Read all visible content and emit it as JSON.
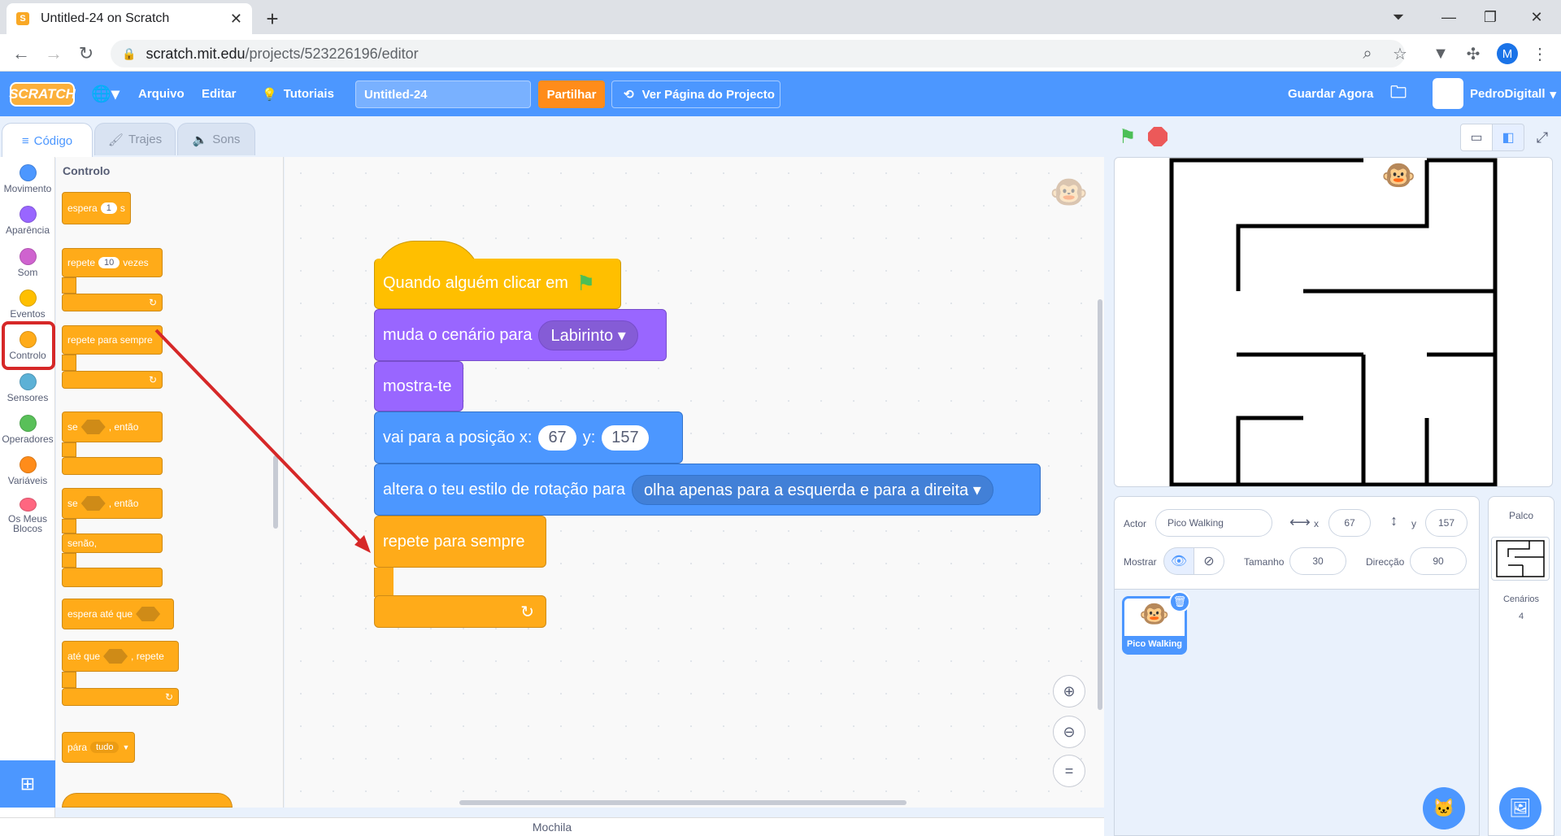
{
  "browser": {
    "tab_title": "Untitled-24 on Scratch",
    "new_tab": "+",
    "url_host": "scratch.mit.edu",
    "url_path": "/projects/523226196/editor",
    "profile_initial": "M"
  },
  "menubar": {
    "logo": "SCRATCH",
    "file": "Arquivo",
    "edit": "Editar",
    "tutorials": "Tutoriais",
    "project_title": "Untitled-24",
    "share": "Partilhar",
    "see_project": "Ver Página do Projecto",
    "save_now": "Guardar Agora",
    "username": "PedroDigitall"
  },
  "editor_tabs": {
    "code": "Código",
    "costumes": "Trajes",
    "sounds": "Sons"
  },
  "categories": [
    {
      "label": "Movimento",
      "color": "#4c97ff"
    },
    {
      "label": "Aparência",
      "color": "#9966ff"
    },
    {
      "label": "Som",
      "color": "#cf63cf"
    },
    {
      "label": "Eventos",
      "color": "#ffbf00"
    },
    {
      "label": "Controlo",
      "color": "#ffab19"
    },
    {
      "label": "Sensores",
      "color": "#5cb1d6"
    },
    {
      "label": "Operadores",
      "color": "#59c059"
    },
    {
      "label": "Variáveis",
      "color": "#ff8c1a"
    },
    {
      "label": "Os Meus Blocos",
      "color": "#ff6680"
    }
  ],
  "palette": {
    "title": "Controlo",
    "wait": {
      "label": "espera",
      "value": "1",
      "unit": "s"
    },
    "repeat": {
      "label": "repete",
      "value": "10",
      "unit": "vezes"
    },
    "forever": "repete para sempre",
    "if_then": {
      "if": "se",
      "then": ", então"
    },
    "if_else": {
      "if": "se",
      "then": ", então",
      "else": "senão,"
    },
    "wait_until": "espera até que",
    "repeat_until": {
      "label": "até que",
      "suffix": ", repete"
    },
    "stop": {
      "label": "pára",
      "option": "tudo"
    }
  },
  "script": {
    "hat": "Quando alguém clicar em",
    "backdrop": {
      "label": "muda o cenário para",
      "value": "Labirinto"
    },
    "show": "mostra-te",
    "goto": {
      "label": "vai para a posição x:",
      "x": "67",
      "y_label": "y:",
      "y": "157"
    },
    "rotation": {
      "label": "altera o teu estilo de rotação para",
      "value": "olha apenas para a esquerda e para a direita"
    },
    "forever": "repete para sempre"
  },
  "backpack": "Mochila",
  "sprite_info": {
    "actor_label": "Actor",
    "actor_name": "Pico Walking",
    "x_label": "x",
    "x": "67",
    "y_label": "y",
    "y": "157",
    "show_label": "Mostrar",
    "size_label": "Tamanho",
    "size": "30",
    "direction_label": "Direcção",
    "direction": "90"
  },
  "sprite_tile": "Pico Walking",
  "stage_panel": {
    "title": "Palco",
    "backdrops_label": "Cenários",
    "backdrops_count": "4"
  },
  "colors": {
    "scratch_blue": "#4c97ff",
    "control": "#ffab19",
    "looks": "#9966ff",
    "motion": "#4c97ff",
    "events": "#ffbf00",
    "highlight": "#d62828"
  }
}
